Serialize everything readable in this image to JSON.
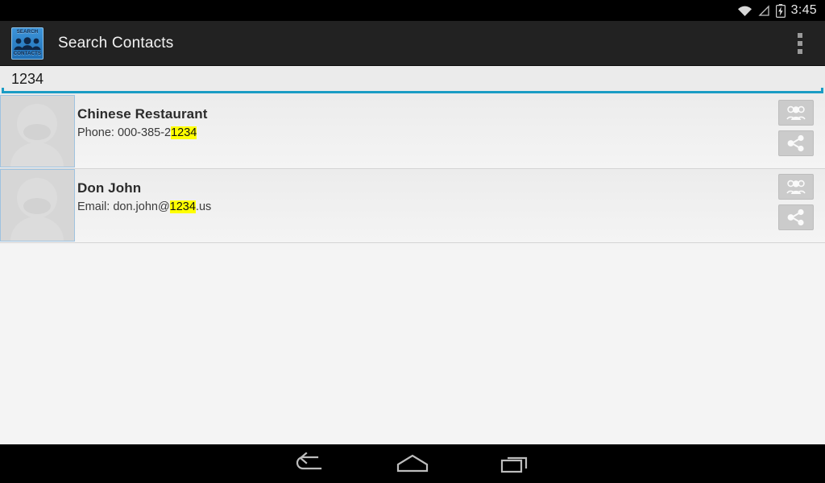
{
  "status_bar": {
    "time": "3:45",
    "icons": [
      "wifi-icon",
      "signal-icon",
      "battery-charging-icon"
    ]
  },
  "action_bar": {
    "app_icon": {
      "name": "search-contacts-app-icon",
      "top_text": "SEARCH",
      "bottom_text": "CONTACTS",
      "background_color": "#2f86cc"
    },
    "title": "Search Contacts",
    "overflow_menu": "overflow-menu-icon"
  },
  "search": {
    "value": "1234",
    "placeholder": "",
    "underline_color": "#1a9cc4"
  },
  "contacts": [
    {
      "name": "Chinese Restaurant",
      "detail_prefix": "Phone: 000-385-2",
      "detail_match": "1234",
      "detail_suffix": "",
      "avatar": "default-contact-avatar",
      "actions": [
        "view-contact-button",
        "share-contact-button"
      ]
    },
    {
      "name": "Don John",
      "detail_prefix": "Email: don.john@",
      "detail_match": "1234",
      "detail_suffix": ".us",
      "avatar": "default-contact-avatar",
      "actions": [
        "view-contact-button",
        "share-contact-button"
      ]
    }
  ],
  "highlight_color": "#ffff00",
  "nav_bar": {
    "back": "back-icon",
    "home": "home-icon",
    "recents": "recents-icon"
  }
}
